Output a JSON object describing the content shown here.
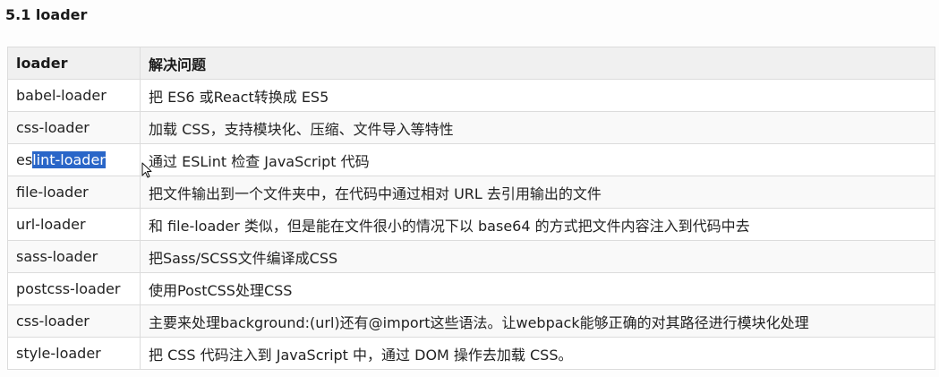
{
  "section": {
    "title": "5.1 loader"
  },
  "table": {
    "headers": [
      "loader",
      "解决问题"
    ],
    "rows": [
      [
        "babel-loader",
        "把 ES6 或React转换成 ES5"
      ],
      [
        "css-loader",
        "加载 CSS，支持模块化、压缩、文件导入等特性"
      ],
      [
        "eslint-loader",
        "通过 ESLint 检查 JavaScript 代码"
      ],
      [
        "file-loader",
        "把文件输出到一个文件夹中，在代码中通过相对 URL 去引用输出的文件"
      ],
      [
        "url-loader",
        "和 file-loader 类似，但是能在文件很小的情况下以 base64 的方式把文件内容注入到代码中去"
      ],
      [
        "sass-loader",
        "把Sass/SCSS文件编译成CSS"
      ],
      [
        "postcss-loader",
        "使用PostCSS处理CSS"
      ],
      [
        "css-loader",
        "主要来处理background:(url)还有@import这些语法。让webpack能够正确的对其路径进行模块化处理"
      ],
      [
        "style-loader",
        "把 CSS 代码注入到 JavaScript 中，通过 DOM 操作去加载 CSS。"
      ]
    ],
    "selection": {
      "row": 2,
      "prefix": "es",
      "selected": "lint-loader"
    }
  },
  "icons": {
    "cursor": "mouse-pointer-icon"
  },
  "colors": {
    "header_bg": "#f0f0f0",
    "border": "#dcdcdc",
    "selection": "#2a66c8"
  }
}
